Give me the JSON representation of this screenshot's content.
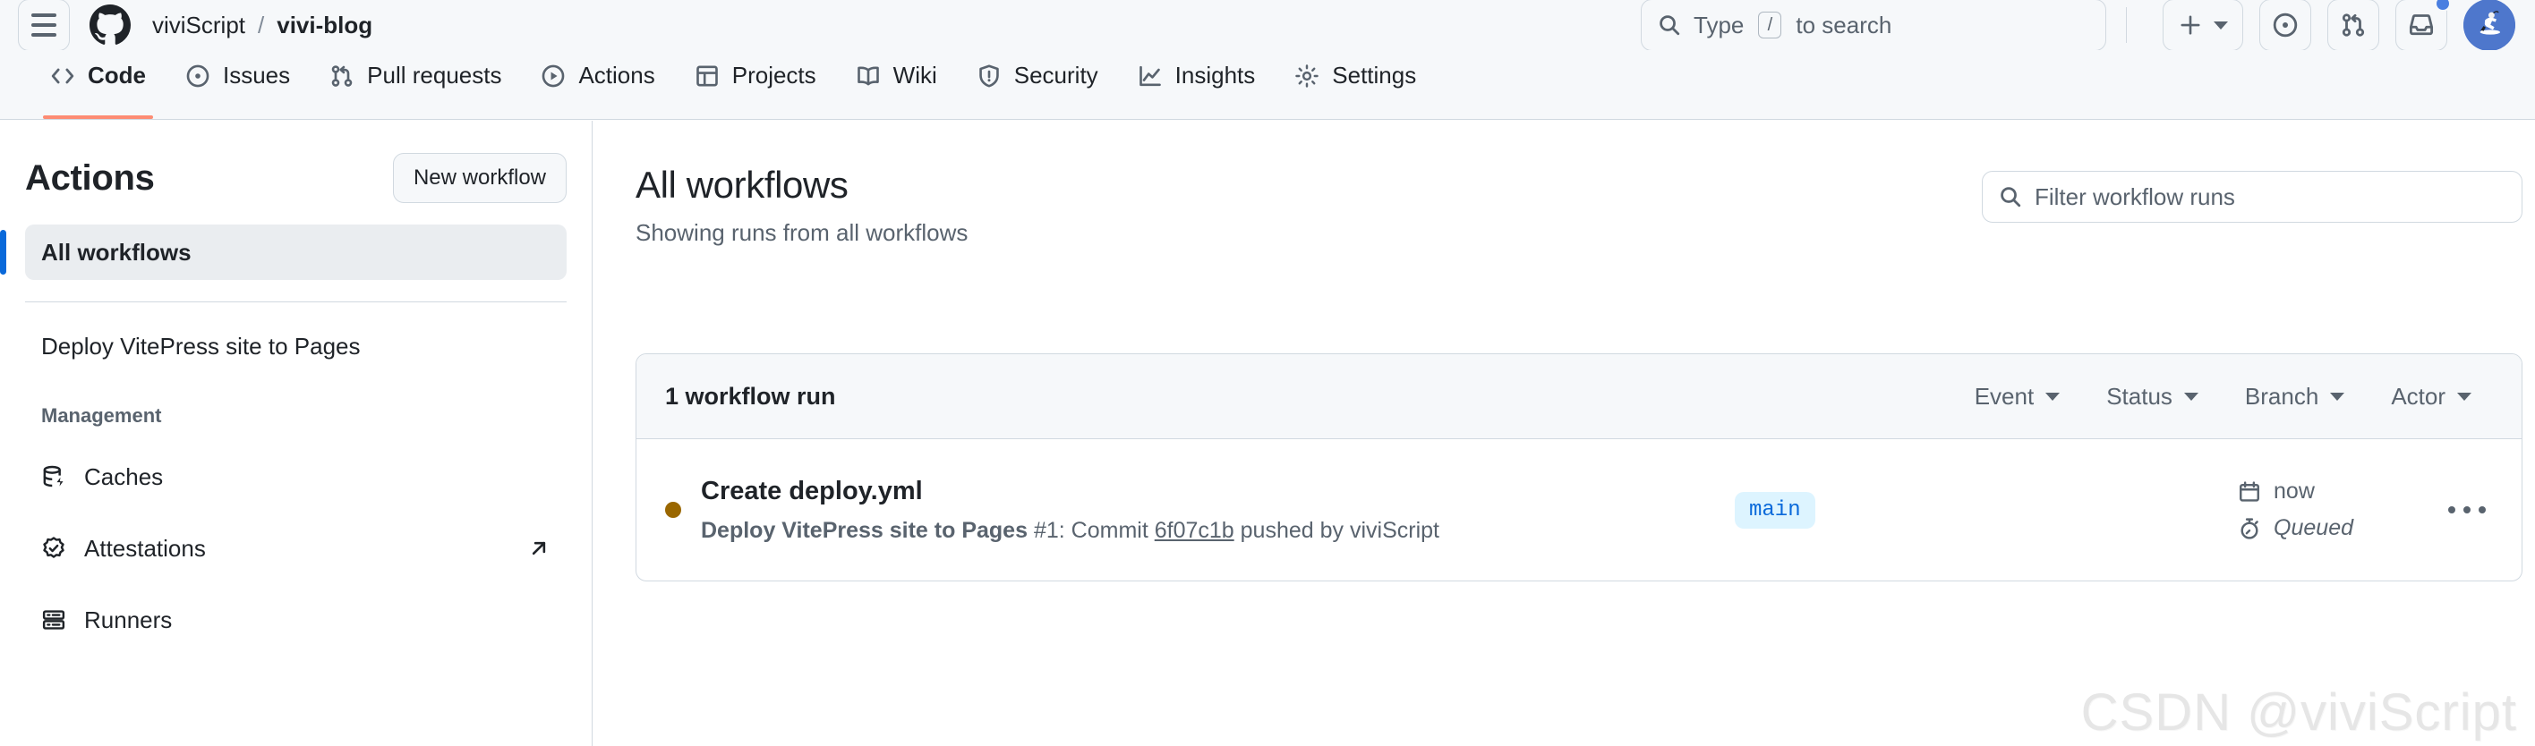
{
  "header": {
    "menu_icon": "hamburger-menu-icon",
    "logo_icon": "github-mark-icon",
    "repo_owner": "viviScript",
    "separator": "/",
    "repo_name": "vivi-blog",
    "search": {
      "icon": "search-icon",
      "text_before": "Type",
      "key_hint": "/",
      "text_after": "to search"
    },
    "actions": [
      {
        "name": "create-new-button",
        "icon": "plus-icon",
        "has_caret": true
      },
      {
        "name": "issues-button",
        "icon": "issue-opened-icon",
        "has_caret": false
      },
      {
        "name": "pull-requests-button",
        "icon": "git-pull-request-icon",
        "has_caret": false
      },
      {
        "name": "inbox-button",
        "icon": "inbox-icon",
        "has_caret": false,
        "badge": true
      }
    ],
    "avatar": {
      "name": "user-avatar",
      "color": "#4e77cc"
    }
  },
  "repo_nav": {
    "tabs": [
      {
        "label": "Code",
        "icon": "code-icon",
        "active": true
      },
      {
        "label": "Issues",
        "icon": "issue-opened-icon",
        "active": false
      },
      {
        "label": "Pull requests",
        "icon": "git-pull-request-icon",
        "active": false
      },
      {
        "label": "Actions",
        "icon": "play-icon",
        "active": false
      },
      {
        "label": "Projects",
        "icon": "table-icon",
        "active": false
      },
      {
        "label": "Wiki",
        "icon": "book-icon",
        "active": false
      },
      {
        "label": "Security",
        "icon": "shield-icon",
        "active": false
      },
      {
        "label": "Insights",
        "icon": "graph-icon",
        "active": false
      },
      {
        "label": "Settings",
        "icon": "gear-icon",
        "active": false
      }
    ],
    "active_underline_color": "#fd8c73"
  },
  "sidebar": {
    "title": "Actions",
    "new_workflow_label": "New workflow",
    "all_workflows": {
      "label": "All workflows",
      "selected": true,
      "accent": "#0969da"
    },
    "workflows": [
      {
        "label": "Deploy VitePress site to Pages"
      }
    ],
    "management_label": "Management",
    "management_items": [
      {
        "label": "Caches",
        "icon": "database-icon",
        "external": false
      },
      {
        "label": "Attestations",
        "icon": "verified-check-icon",
        "external": true
      },
      {
        "label": "Runners",
        "icon": "server-icon",
        "external": false
      }
    ]
  },
  "main": {
    "title": "All workflows",
    "subtitle": "Showing runs from all workflows",
    "filter_input": {
      "icon": "search-icon",
      "placeholder": "Filter workflow runs",
      "value": ""
    },
    "card": {
      "run_count_label": "1 workflow run",
      "filters": [
        {
          "label": "Event",
          "icon": "chevron-down-icon"
        },
        {
          "label": "Status",
          "icon": "chevron-down-icon"
        },
        {
          "label": "Branch",
          "icon": "chevron-down-icon"
        },
        {
          "label": "Actor",
          "icon": "chevron-down-icon"
        }
      ],
      "runs": [
        {
          "status_color": "#9a6700",
          "status_name": "queued-status-dot",
          "title": "Create deploy.yml",
          "workflow_name": "Deploy VitePress site to Pages",
          "run_number": "#1:",
          "commit_word": "Commit",
          "commit_sha": "6f07c1b",
          "pushed_by_text": "pushed by",
          "actor": "viviScript",
          "branch": "main",
          "branch_bg": "#ddf4ff",
          "branch_fg": "#0969da",
          "time_icon": "calendar-icon",
          "time_label": "now",
          "duration_icon": "stopwatch-icon",
          "duration_label": "Queued",
          "menu_icon": "kebab-horizontal-icon"
        }
      ]
    }
  },
  "watermark": {
    "text": "CSDN @viviScript"
  }
}
